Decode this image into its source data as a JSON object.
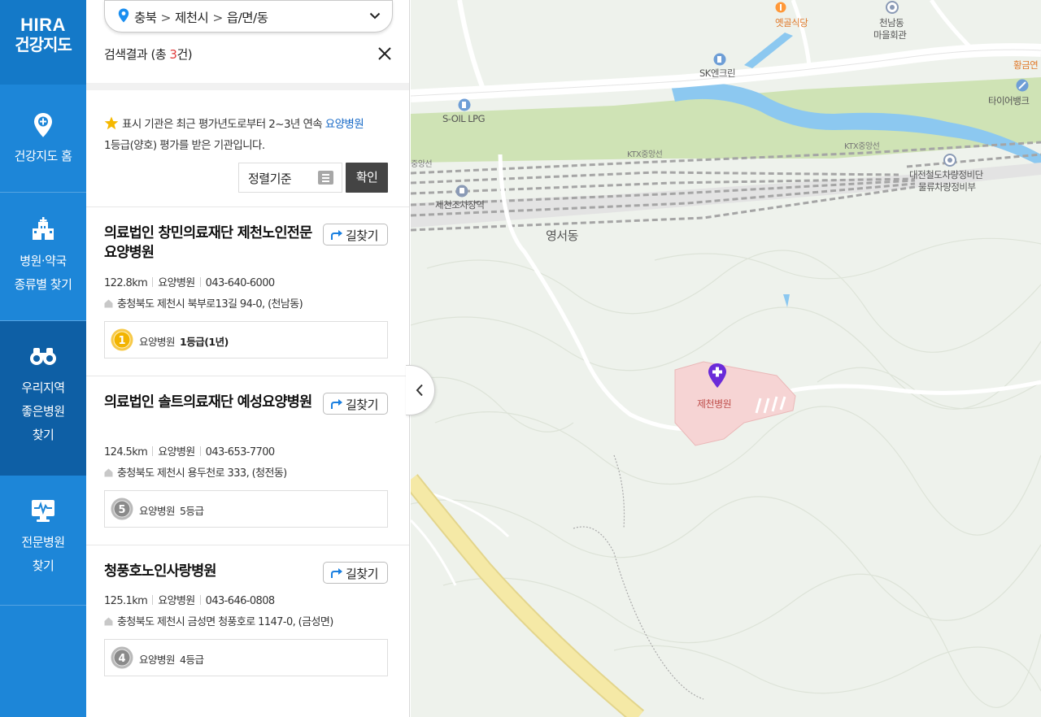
{
  "nav": {
    "logo_line1": "HIRA",
    "logo_line2": "건강지도",
    "items": [
      {
        "label_lines": [
          "건강지도 홈"
        ],
        "icon": "map-pin-icon"
      },
      {
        "label_lines": [
          "병원·약국",
          "종류별 찾기"
        ],
        "icon": "hospital-building-icon"
      },
      {
        "label_lines": [
          "우리지역",
          "좋은병원",
          "찾기"
        ],
        "icon": "binoculars-icon",
        "active": true
      },
      {
        "label_lines": [
          "전문병원",
          "찾기"
        ],
        "icon": "monitor-heartbeat-icon"
      }
    ],
    "colors": {
      "bg": "#1d86d8",
      "active": "#0e5fa5",
      "logo_bg": "#1479c8"
    }
  },
  "region": {
    "level1": "충북",
    "level2": "제천시",
    "level3": "읍/면/동",
    "separator": ">"
  },
  "search": {
    "result_prefix": "검색결과 (총 ",
    "result_count": "3",
    "result_suffix": "건)"
  },
  "notice": {
    "text_before": "표시 기관은 최근 평가년도로부터 2~3년 연속 ",
    "highlight": "요양병원",
    "text_line2": "1등급(양호) 평가를 받은 기관입니다."
  },
  "sort": {
    "label": "정렬기준",
    "confirm": "확인"
  },
  "results": [
    {
      "name": "의료법인 창민의료재단 제천노인전문요양병원",
      "route_label": "길찾기",
      "distance": "122.8km",
      "type": "요양병원",
      "phone": "043-640-6000",
      "address": "충청북도 제천시 북부로13길 94-0, (천남동)",
      "grade_type": "요양병원",
      "grade_label": "1등급(1년)",
      "medal_number": "1",
      "medal_color": "#f2b400"
    },
    {
      "name": "의료법인 솔트의료재단 예성요양병원",
      "route_label": "길찾기",
      "distance": "124.5km",
      "type": "요양병원",
      "phone": "043-653-7700",
      "address": "충청북도 제천시 용두천로 333, (청전동)",
      "grade_type": "요양병원",
      "grade_label": "5등급",
      "medal_number": "5",
      "medal_color": "#8a8a8a"
    },
    {
      "name": "청풍호노인사랑병원",
      "route_label": "길찾기",
      "distance": "125.1km",
      "type": "요양병원",
      "phone": "043-646-0808",
      "address": "충청북도 제천시 금성면 청풍호로 1147-0, (금성면)",
      "grade_type": "요양병원",
      "grade_label": "4등급",
      "medal_number": "4",
      "medal_color": "#8a8a8a"
    }
  ],
  "map": {
    "labels": {
      "restaurant": "옛골식당",
      "hall_l1": "천남동",
      "hall_l2": "마을회관",
      "gas1": "SK엔크린",
      "gas2": "S-OIL LPG",
      "ktx1": "KTX중앙선",
      "ktx2": "KTX중앙선",
      "rail_west": "중앙선",
      "depot_l1": "대전철도차량정비단",
      "depot_l2": "물류차량정비부",
      "station": "제천조차장역",
      "district": "영서동",
      "hospital": "제천병원",
      "top_right1": "황금연",
      "top_right2": "타이어뱅크"
    },
    "colors": {
      "water": "#8cc8f0",
      "green": "#cfe3b5",
      "road": "#ffffff",
      "highway": "#f5e9a6",
      "marker": "#6a2bd9"
    }
  }
}
